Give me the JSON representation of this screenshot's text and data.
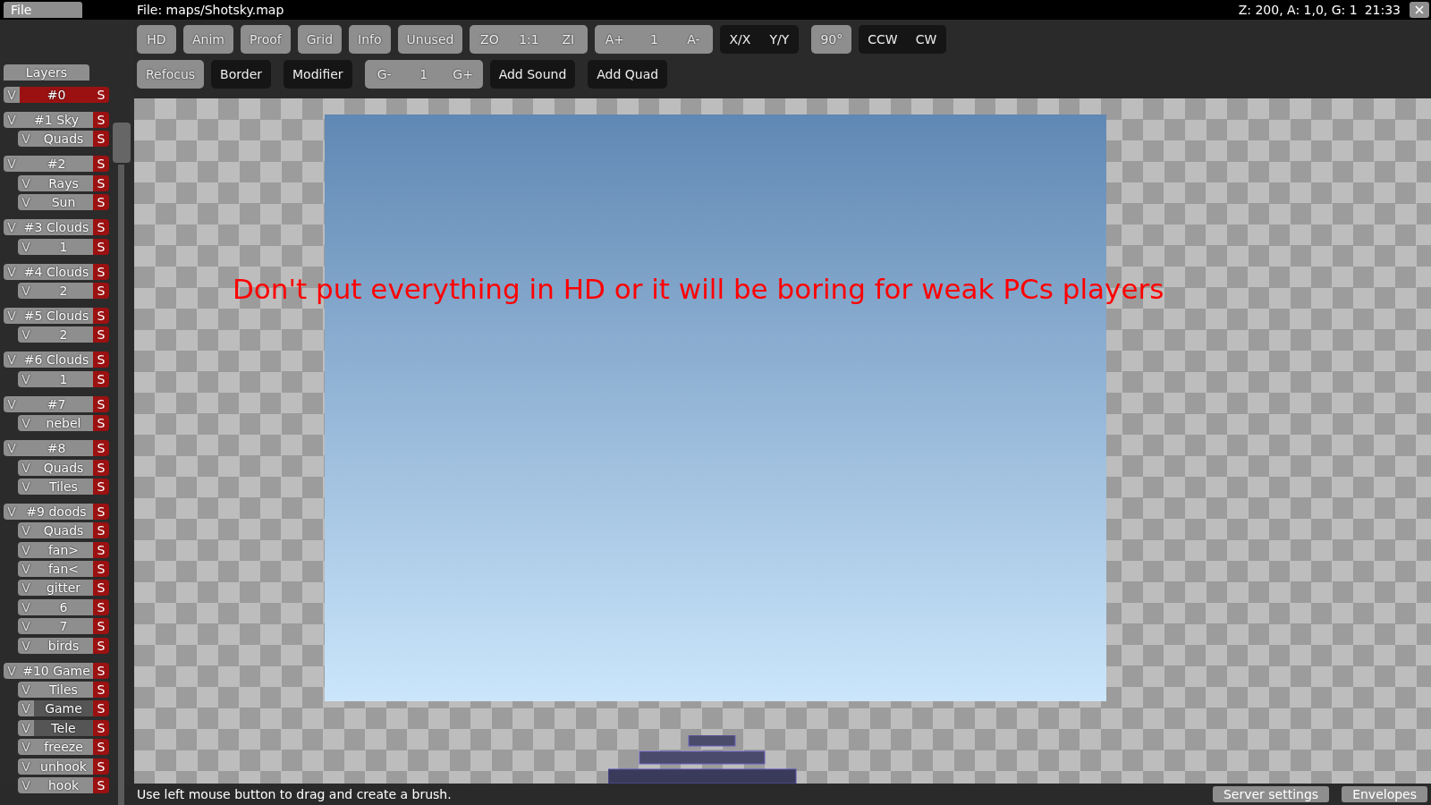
{
  "menu": {
    "file": "File"
  },
  "window": {
    "title": "File: maps/Shotsky.map",
    "status": "Z: 200, A: 1,0, G: 1",
    "clock": "21:33"
  },
  "toolbar": {
    "rows": [
      {
        "segments": [
          {
            "kind": "toggle",
            "buttons": [
              "HD"
            ]
          },
          {
            "kind": "toggle",
            "buttons": [
              "Anim"
            ]
          },
          {
            "kind": "toggle",
            "buttons": [
              "Proof"
            ]
          },
          {
            "kind": "toggle",
            "buttons": [
              "Grid"
            ]
          },
          {
            "kind": "toggle",
            "buttons": [
              "Info"
            ]
          },
          {
            "kind": "toggle",
            "buttons": [
              "Unused"
            ]
          },
          {
            "kind": "toggle",
            "buttons": [
              "ZO",
              "1:1",
              "ZI"
            ]
          },
          {
            "kind": "toggle",
            "buttons": [
              "A+",
              "1",
              "A-"
            ]
          },
          {
            "kind": "action",
            "buttons": [
              "X/X",
              "Y/Y"
            ]
          },
          {
            "kind": "toggle",
            "buttons": [
              "90°"
            ]
          },
          {
            "kind": "action",
            "buttons": [
              "CCW",
              "CW"
            ]
          }
        ]
      },
      {
        "segments": [
          {
            "kind": "toggle",
            "buttons": [
              "Refocus"
            ]
          },
          {
            "kind": "action",
            "buttons": [
              "Border"
            ]
          },
          {
            "kind": "action",
            "buttons": [
              "Modifier"
            ]
          },
          {
            "kind": "toggle",
            "buttons": [
              "G-",
              "1",
              "G+"
            ]
          },
          {
            "kind": "action",
            "buttons": [
              "Add Sound"
            ]
          },
          {
            "kind": "action",
            "buttons": [
              "Add Quad"
            ]
          }
        ]
      }
    ]
  },
  "sidebar": {
    "tab": "Layers",
    "groups": [
      {
        "visible": "V",
        "name": "#0",
        "solo": "S",
        "selected": true
      },
      {
        "visible": "V",
        "name": "#1 Sky",
        "solo": "S",
        "selected": false,
        "layers": [
          {
            "visible": "V",
            "name": "Quads",
            "solo": "S",
            "selected": false
          }
        ]
      },
      {
        "visible": "V",
        "name": "#2",
        "solo": "S",
        "selected": false,
        "layers": [
          {
            "visible": "V",
            "name": "Rays",
            "solo": "S",
            "selected": false
          },
          {
            "visible": "V",
            "name": "Sun",
            "solo": "S",
            "selected": false
          }
        ]
      },
      {
        "visible": "V",
        "name": "#3 Clouds",
        "solo": "S",
        "selected": false,
        "layers": [
          {
            "visible": "V",
            "name": "1",
            "solo": "S",
            "selected": false
          }
        ]
      },
      {
        "visible": "V",
        "name": "#4 Clouds",
        "solo": "S",
        "selected": false,
        "layers": [
          {
            "visible": "V",
            "name": "2",
            "solo": "S",
            "selected": false
          }
        ]
      },
      {
        "visible": "V",
        "name": "#5 Clouds",
        "solo": "S",
        "selected": false,
        "layers": [
          {
            "visible": "V",
            "name": "2",
            "solo": "S",
            "selected": false
          }
        ]
      },
      {
        "visible": "V",
        "name": "#6 Clouds",
        "solo": "S",
        "selected": false,
        "layers": [
          {
            "visible": "V",
            "name": "1",
            "solo": "S",
            "selected": false
          }
        ]
      },
      {
        "visible": "V",
        "name": "#7",
        "solo": "S",
        "selected": false,
        "layers": [
          {
            "visible": "V",
            "name": "nebel",
            "solo": "S",
            "selected": false
          }
        ]
      },
      {
        "visible": "V",
        "name": "#8",
        "solo": "S",
        "selected": false,
        "layers": [
          {
            "visible": "V",
            "name": "Quads",
            "solo": "S",
            "selected": false
          },
          {
            "visible": "V",
            "name": "Tiles",
            "solo": "S",
            "selected": false
          }
        ]
      },
      {
        "visible": "V",
        "name": "#9 doods",
        "solo": "S",
        "selected": false,
        "layers": [
          {
            "visible": "V",
            "name": "Quads",
            "solo": "S",
            "selected": false
          },
          {
            "visible": "V",
            "name": "fan>",
            "solo": "S",
            "selected": false
          },
          {
            "visible": "V",
            "name": "fan<",
            "solo": "S",
            "selected": false
          },
          {
            "visible": "V",
            "name": "gitter",
            "solo": "S",
            "selected": false
          },
          {
            "visible": "V",
            "name": "6",
            "solo": "S",
            "selected": false
          },
          {
            "visible": "V",
            "name": "7",
            "solo": "S",
            "selected": false
          },
          {
            "visible": "V",
            "name": "birds",
            "solo": "S",
            "selected": false
          }
        ]
      },
      {
        "visible": "V",
        "name": "#10 Game",
        "solo": "S",
        "selected": false,
        "layers": [
          {
            "visible": "V",
            "name": "Tiles",
            "solo": "S",
            "selected": false
          },
          {
            "visible": "V",
            "name": "Game",
            "solo": "S",
            "selected": true
          },
          {
            "visible": "V",
            "name": "Tele",
            "solo": "S",
            "selected": true
          },
          {
            "visible": "V",
            "name": "freeze",
            "solo": "S",
            "selected": false
          },
          {
            "visible": "V",
            "name": "unhook",
            "solo": "S",
            "selected": false
          },
          {
            "visible": "V",
            "name": "hook",
            "solo": "S",
            "selected": false
          }
        ]
      }
    ]
  },
  "canvas": {
    "message": "Don't put everything in HD or it will be boring for weak PCs players"
  },
  "status_bar": {
    "hint": "Use left mouse button to drag and create a brush.",
    "buttons": [
      "Server settings",
      "Envelopes"
    ]
  }
}
